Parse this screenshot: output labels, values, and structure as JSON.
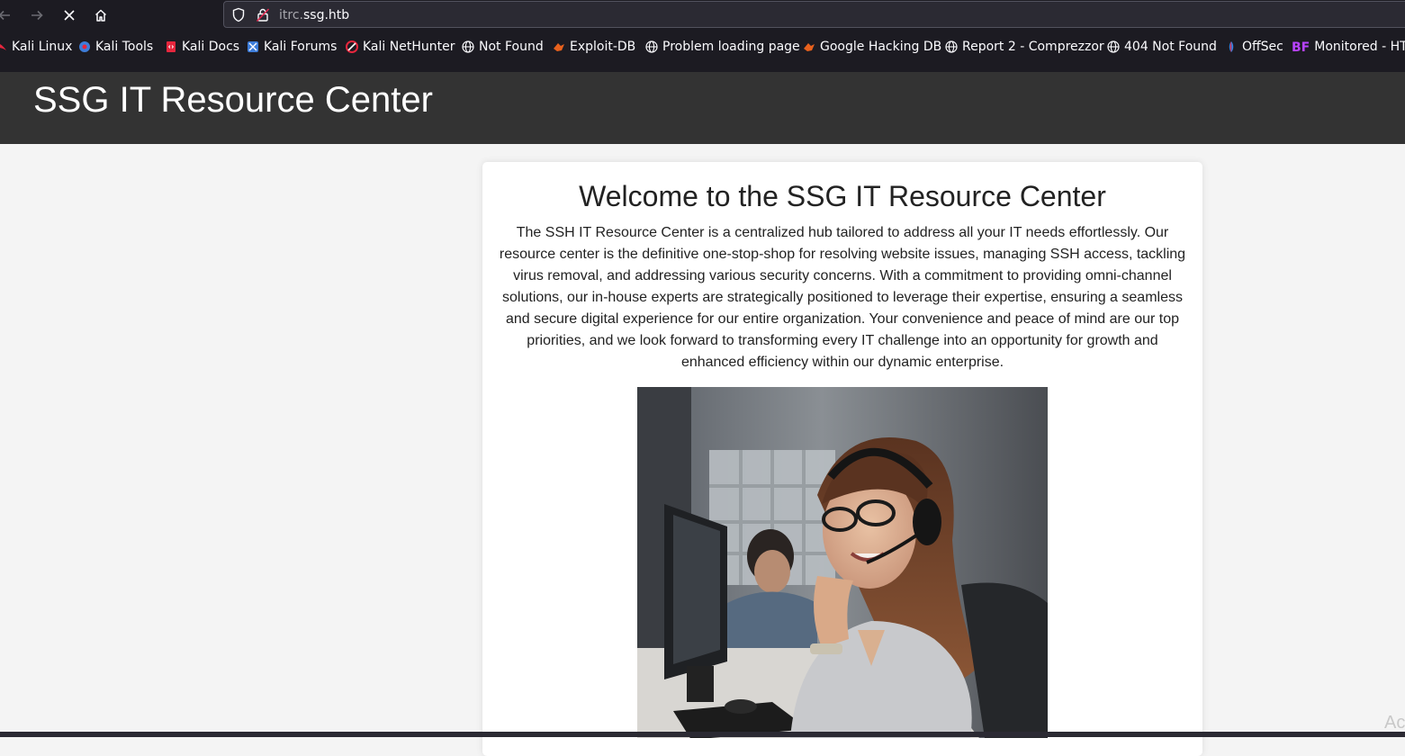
{
  "browser": {
    "url_host": "itrc.",
    "url_domain": "ssg.htb",
    "bookmarks": [
      {
        "label": "Kali Linux",
        "icon": "kali-dragon-icon"
      },
      {
        "label": "Kali Tools",
        "icon": "kali-tools-icon"
      },
      {
        "label": "Kali Docs",
        "icon": "kali-docs-icon"
      },
      {
        "label": "Kali Forums",
        "icon": "kali-forums-icon"
      },
      {
        "label": "Kali NetHunter",
        "icon": "kali-nethunter-icon"
      },
      {
        "label": "Not Found",
        "icon": "globe-icon"
      },
      {
        "label": "Exploit-DB",
        "icon": "exploit-db-icon"
      },
      {
        "label": "Problem loading page",
        "icon": "globe-icon"
      },
      {
        "label": "Google Hacking DB",
        "icon": "exploit-db-icon"
      },
      {
        "label": "Report 2 - Comprezzor",
        "icon": "globe-icon"
      },
      {
        "label": "404 Not Found",
        "icon": "globe-icon"
      },
      {
        "label": "OffSec",
        "icon": "offsec-icon"
      },
      {
        "label": "Monitored - HTB",
        "icon": "bf-icon",
        "badge": "BF"
      }
    ]
  },
  "site": {
    "title": "SSG IT Resource Center",
    "welcome_heading": "Welcome to the SSG IT Resource Center",
    "intro": "The SSH IT Resource Center is a centralized hub tailored to address all your IT needs effortlessly. Our resource center is the definitive one-stop-shop for resolving website issues, managing SSH access, tackling virus removal, and addressing various security concerns. With a commitment to providing omni-channel solutions, our in-house experts are strategically positioned to leverage their expertise, ensuring a seamless and secure digital experience for our entire organization. Your convenience and peace of mind are our top priorities, and we look forward to transforming every IT challenge into an opportunity for growth and enhanced efficiency within our dynamic enterprise."
  },
  "overlay": {
    "watermark": "Ac"
  },
  "colors": {
    "header_bg": "#333333",
    "page_bg": "#f4f4f4",
    "chrome_bg": "#1c1b22"
  }
}
